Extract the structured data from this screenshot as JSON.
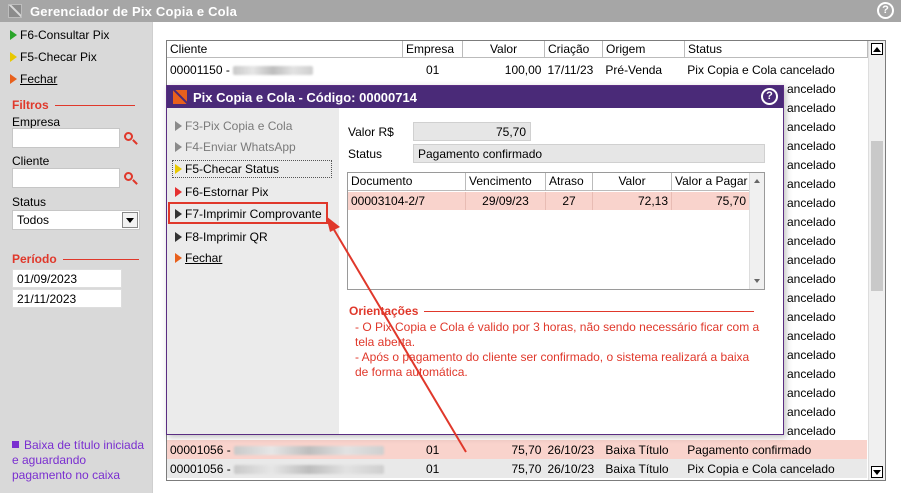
{
  "app": {
    "title": "Gerenciador de Pix Copia e Cola",
    "help_icon": "?"
  },
  "sidebar": {
    "actions": [
      {
        "label": "F6-Consultar Pix",
        "icon": "play-green-icon"
      },
      {
        "label": "F5-Checar Pix",
        "icon": "play-yellow-icon"
      },
      {
        "label": "Fechar",
        "icon": "play-orange-icon"
      }
    ],
    "filters_title": "Filtros",
    "empresa_label": "Empresa",
    "empresa_value": "",
    "cliente_label": "Cliente",
    "cliente_value": "",
    "status_label": "Status",
    "status_value": "Todos",
    "periodo_title": "Período",
    "date_from": "01/09/2023",
    "date_to": "21/11/2023",
    "legend_text": "Baixa de título iniciada e aguardando pagamento no caixa"
  },
  "grid": {
    "columns": [
      "Cliente",
      "Empresa",
      "Valor",
      "Criação",
      "Origem",
      "Status"
    ],
    "rows": [
      {
        "cliente": "00001150 -",
        "empresa": "01",
        "valor": "100,00",
        "criacao": "17/11/23",
        "origem": "Pré-Venda",
        "status": "Pix Copia e Cola cancelado",
        "style": "normal"
      },
      {
        "cliente": "00001056 -",
        "empresa": "01",
        "valor": "75,70",
        "criacao": "26/10/23",
        "origem": "Baixa Título",
        "status": "Pagamento confirmado",
        "style": "pink"
      },
      {
        "cliente": "00001056 -",
        "empresa": "01",
        "valor": "75,70",
        "criacao": "26/10/23",
        "origem": "Baixa Título",
        "status": "Pix Copia e Cola cancelado",
        "style": "gray"
      }
    ],
    "background_status": "ancelado"
  },
  "modal": {
    "title": "Pix Copia e Cola - Código: 00000714",
    "help_icon": "?",
    "actions": [
      {
        "label": "F3-Pix Copia e Cola",
        "state": "disabled"
      },
      {
        "label": "F4-Enviar WhatsApp",
        "state": "disabled"
      },
      {
        "label": "F5-Checar Status",
        "state": "focused"
      },
      {
        "label": "F6-Estornar Pix",
        "state": "normal"
      },
      {
        "label": "F7-Imprimir Comprovante",
        "state": "highlighted"
      },
      {
        "label": "F8-Imprimir QR",
        "state": "normal"
      },
      {
        "label": "Fechar",
        "state": "normal"
      }
    ],
    "valor_label": "Valor R$",
    "valor_value": "75,70",
    "status_label": "Status",
    "status_value": "Pagamento confirmado",
    "subgrid": {
      "columns": [
        "Documento",
        "Vencimento",
        "Atraso",
        "Valor",
        "Valor a Pagar"
      ],
      "rows": [
        {
          "documento": "00003104-2/7",
          "vencimento": "29/09/23",
          "atraso": "27",
          "valor": "72,13",
          "valor_pagar": "75,70"
        }
      ]
    },
    "orientacoes_title": "Orientações",
    "orientacoes_lines": [
      "- O Pix Copia e Cola é valido por 3 horas, não sendo necessário ficar com a tela aberta.",
      "- Após o pagamento do cliente ser confirmado, o sistema realizará a baixa de forma automática."
    ]
  },
  "colors": {
    "accent_red": "#e0382b",
    "modal_title_bg": "#4a2a78",
    "legend_purple": "#7a2fd0",
    "pink_row": "#f9d3cc"
  }
}
